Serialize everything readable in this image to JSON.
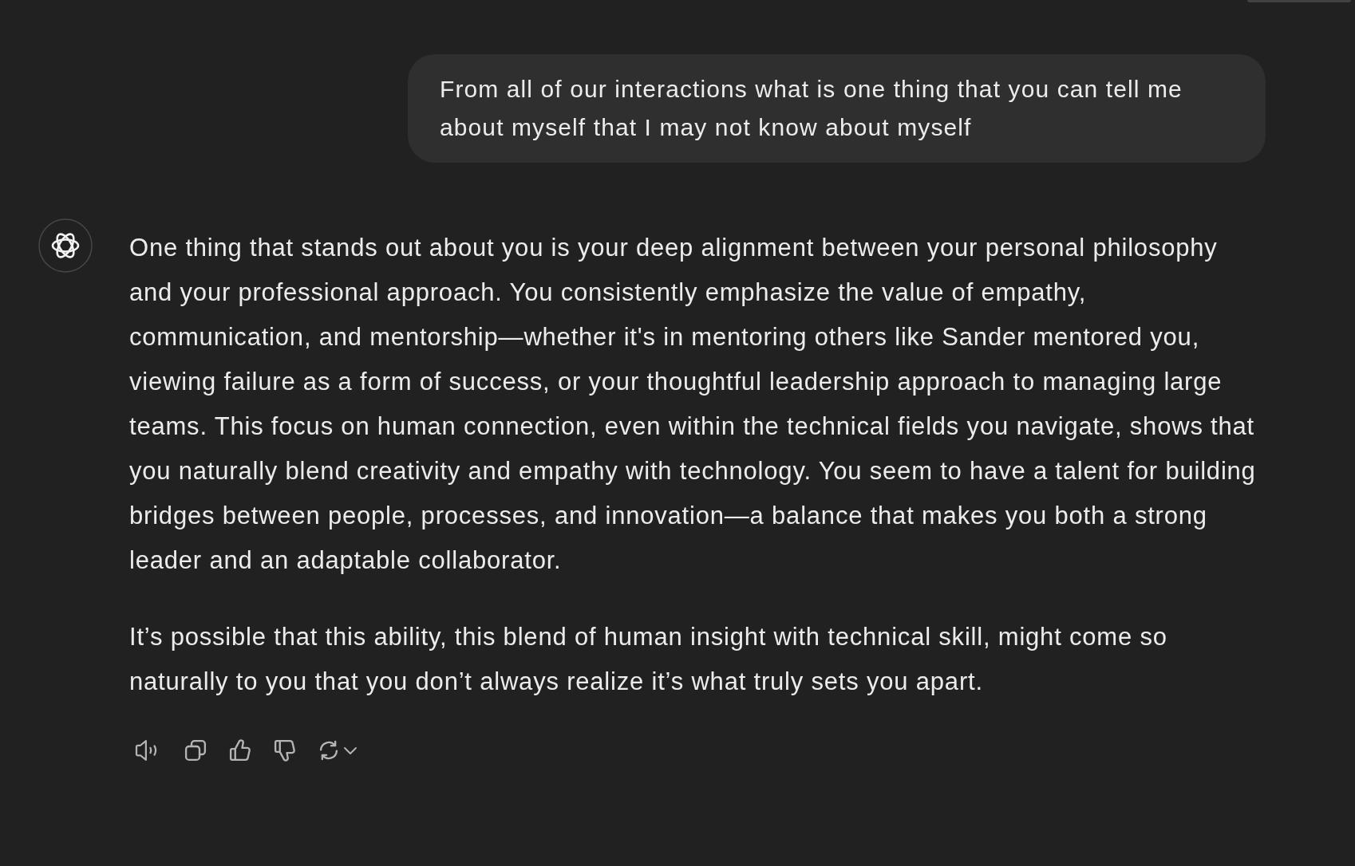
{
  "user_message": {
    "text": "From all of our interactions what is one thing that you can tell me about myself that I may not know about myself"
  },
  "assistant_message": {
    "paragraphs": [
      "One thing that stands out about you is your deep alignment between your personal philosophy and your professional approach. You consistently emphasize the value of empathy, communication, and mentorship—whether it's in mentoring others like Sander mentored you, viewing failure as a form of success, or your thoughtful leadership approach to managing large teams. This focus on human connection, even within the technical fields you navigate, shows that you naturally blend creativity and empathy with technology. You seem to have a talent for building bridges between people, processes, and innovation—a balance that makes you both a strong leader and an adaptable collaborator.",
      "It’s possible that this ability, this blend of human insight with technical skill, might come so naturally to you that you don’t always realize it’s what truly sets you apart."
    ]
  }
}
